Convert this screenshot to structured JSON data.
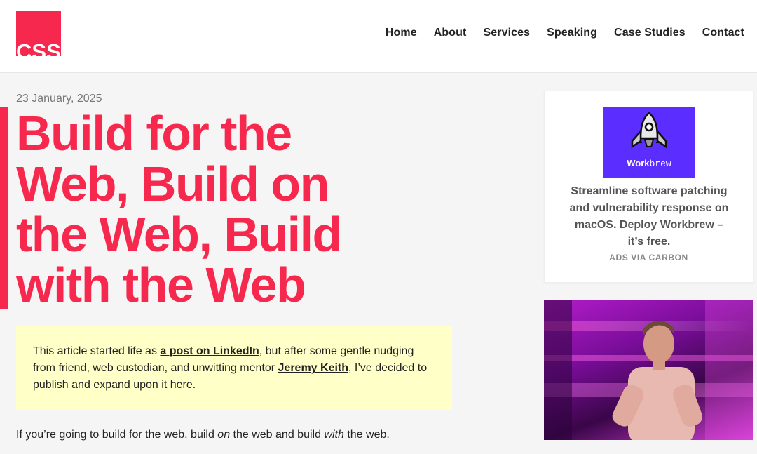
{
  "header": {
    "logo_text": "CSS",
    "nav": [
      "Home",
      "About",
      "Services",
      "Speaking",
      "Case Studies",
      "Contact"
    ]
  },
  "article": {
    "date": "23 January, 2025",
    "title": "Build for the Web, Build on the Web, Build with the Web",
    "callout": {
      "part1": "This article started life as ",
      "link1": "a post on LinkedIn",
      "part2": ", but after some gentle nudging from friend, web custodian, and unwitting mentor ",
      "link2": "Jeremy Keith",
      "part3": ", I’ve decided to publish and expand upon it here."
    },
    "intro": {
      "part1": "If you’re going to build for the web, build ",
      "em1": "on",
      "part2": " the web and build ",
      "em2": "with",
      "part3": " the web."
    }
  },
  "sidebar": {
    "ad": {
      "brand_bold": "Work",
      "brand_mono": "brew",
      "text": "Streamline software patching and vulnerability response on macOS. Deploy Workbrew – it’s free.",
      "via": "ADS VIA CARBON",
      "icon": "rocket-icon",
      "bg_color": "#5b2dff"
    },
    "photo": {
      "icon": "speaker-photo"
    }
  },
  "colors": {
    "accent": "#f7284e",
    "callout_bg": "#ffffc8"
  }
}
